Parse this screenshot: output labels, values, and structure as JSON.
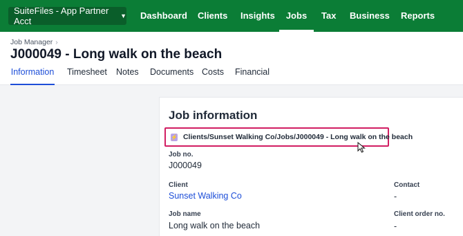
{
  "topnav": {
    "account_label": "SuiteFiles - App Partner Acct",
    "items": [
      {
        "label": "Dashboard"
      },
      {
        "label": "Clients"
      },
      {
        "label": "Insights"
      },
      {
        "label": "Jobs"
      },
      {
        "label": "Tax"
      },
      {
        "label": "Business"
      },
      {
        "label": "Reports"
      }
    ]
  },
  "header": {
    "breadcrumb": "Job Manager",
    "title": "J000049 - Long walk on the beach",
    "tabs": [
      {
        "label": "Information"
      },
      {
        "label": "Timesheet"
      },
      {
        "label": "Notes"
      },
      {
        "label": "Documents"
      },
      {
        "label": "Costs"
      },
      {
        "label": "Financial"
      }
    ]
  },
  "card": {
    "title": "Job information",
    "path": "Clients/Sunset Walking Co/Jobs/J000049 - Long walk on the beach",
    "path_icon": "suitefiles-icon",
    "fields": {
      "job_no_label": "Job no.",
      "job_no_value": "J000049",
      "client_label": "Client",
      "client_value": "Sunset Walking Co",
      "contact_label": "Contact",
      "contact_value": "-",
      "job_name_label": "Job name",
      "job_name_value": "Long walk on the beach",
      "client_order_label": "Client order no.",
      "client_order_value": "-"
    }
  },
  "colors": {
    "nav_bg": "#0b7d36",
    "highlight": "#d11d62",
    "link": "#1d4ed8"
  }
}
